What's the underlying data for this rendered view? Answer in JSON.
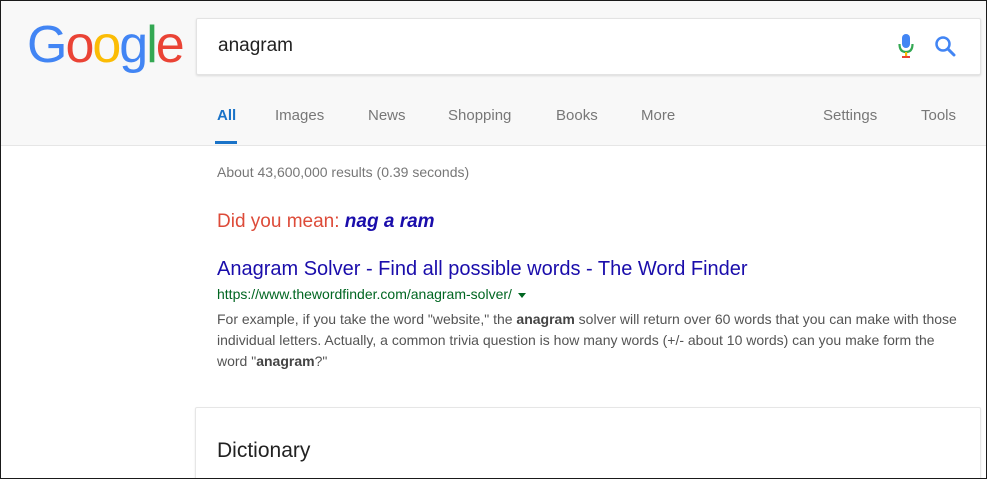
{
  "logo": {
    "letters": [
      "G",
      "o",
      "o",
      "g",
      "l",
      "e"
    ],
    "colors": [
      "#4285f4",
      "#ea4335",
      "#fbbc05",
      "#4285f4",
      "#34a853",
      "#ea4335"
    ]
  },
  "search": {
    "query": "anagram"
  },
  "icons": {
    "mic": "mic-icon",
    "search": "search-icon"
  },
  "tabs": [
    {
      "label": "All",
      "active": true
    },
    {
      "label": "Images"
    },
    {
      "label": "News"
    },
    {
      "label": "Shopping"
    },
    {
      "label": "Books"
    },
    {
      "label": "More"
    },
    {
      "label": "Settings"
    },
    {
      "label": "Tools"
    }
  ],
  "results": {
    "stats": "About 43,600,000 results (0.39 seconds)",
    "did_you_mean": {
      "prefix": "Did you mean: ",
      "suggestion": "nag a ram"
    },
    "items": [
      {
        "title": "Anagram Solver - Find all possible words - The Word Finder",
        "url": "https://www.thewordfinder.com/anagram-solver/",
        "snippet": {
          "s1": "For example, if you take the word \"website,\" the ",
          "b1": "anagram",
          "s2": " solver will return over 60 words that you can make with those individual letters. Actually, a common trivia question is how many words (+/- about 10 words) can you make form the word \"",
          "b2": "anagram",
          "s3": "?\""
        }
      }
    ]
  },
  "dictionary": {
    "title": "Dictionary"
  },
  "colors": {
    "link": "#1a0dab",
    "url": "#006621",
    "tab_active": "#1a73c8",
    "did_you_mean": "#dd4b39"
  }
}
